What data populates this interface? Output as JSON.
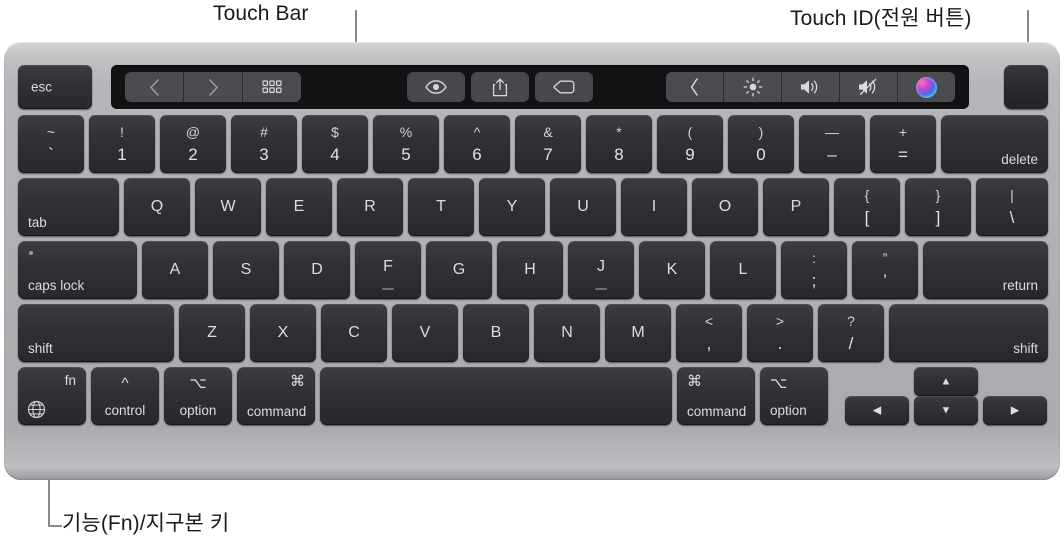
{
  "annotations": [
    {
      "id": "touch-bar",
      "label": "Touch Bar"
    },
    {
      "id": "touch-id",
      "label": "Touch ID(전원 버튼)"
    },
    {
      "id": "fn-globe",
      "label": "기능(Fn)/지구본 키"
    }
  ],
  "touch_bar": {
    "esc_label": "esc",
    "left_group": [
      {
        "name": "back-icon",
        "glyph": "chevron-left"
      },
      {
        "name": "forward-icon",
        "glyph": "chevron-right"
      },
      {
        "name": "grid-view-icon",
        "glyph": "grid"
      }
    ],
    "middle_group": [
      {
        "name": "quick-look-icon",
        "glyph": "eye"
      },
      {
        "name": "share-icon",
        "glyph": "share"
      },
      {
        "name": "tag-icon",
        "glyph": "tag"
      }
    ],
    "control_strip": [
      {
        "name": "expand-control-strip-icon",
        "glyph": "chevron-left"
      },
      {
        "name": "brightness-icon",
        "glyph": "sun"
      },
      {
        "name": "volume-up-icon",
        "glyph": "speaker-waves"
      },
      {
        "name": "mute-icon",
        "glyph": "speaker-muted"
      },
      {
        "name": "siri-icon",
        "glyph": "siri-orb"
      }
    ]
  },
  "touch_id": {
    "label": ""
  },
  "rows": {
    "numbers": [
      {
        "up": "~",
        "down": "`"
      },
      {
        "up": "!",
        "down": "1"
      },
      {
        "up": "@",
        "down": "2"
      },
      {
        "up": "#",
        "down": "3"
      },
      {
        "up": "$",
        "down": "4"
      },
      {
        "up": "%",
        "down": "5"
      },
      {
        "up": "^",
        "down": "6"
      },
      {
        "up": "&",
        "down": "7"
      },
      {
        "up": "*",
        "down": "8"
      },
      {
        "up": "(",
        "down": "9"
      },
      {
        "up": ")",
        "down": "0"
      },
      {
        "up": "—",
        "down": "–"
      },
      {
        "up": "+",
        "down": "="
      }
    ],
    "delete_label": "delete",
    "tab_label": "tab",
    "qwerty": [
      "Q",
      "W",
      "E",
      "R",
      "T",
      "Y",
      "U",
      "I",
      "O",
      "P"
    ],
    "qwerty_dual": [
      {
        "up": "{",
        "down": "["
      },
      {
        "up": "}",
        "down": "]"
      },
      {
        "up": "|",
        "down": "\\"
      }
    ],
    "caps_lock_label": "caps lock",
    "asdf": [
      "A",
      "S",
      "D",
      "F",
      "G",
      "H",
      "J",
      "K",
      "L"
    ],
    "asdf_dual": [
      {
        "up": ":",
        "down": ";"
      },
      {
        "up": "”",
        "down": "’"
      }
    ],
    "return_label": "return",
    "shift_left_label": "shift",
    "zxcv": [
      "Z",
      "X",
      "C",
      "V",
      "B",
      "N",
      "M"
    ],
    "zxcv_dual": [
      {
        "up": "<",
        "down": ","
      },
      {
        "up": ">",
        "down": "."
      },
      {
        "up": "?",
        "down": "/"
      }
    ],
    "shift_right_label": "shift",
    "bottom": {
      "fn_label": "fn",
      "control_glyph": "^",
      "control_label": "control",
      "option_glyph": "⌥",
      "option_label": "option",
      "command_glyph": "⌘",
      "command_label": "command",
      "space_label": "",
      "command_right_glyph": "⌘",
      "command_right_label": "command",
      "option_right_glyph": "⌥",
      "option_right_label": "option",
      "arrow_left": "◀",
      "arrow_up": "▲",
      "arrow_down": "▼",
      "arrow_right": "▶"
    }
  },
  "colors": {
    "body": "#aeb0b3",
    "key": "#2f3134",
    "key_text": "#dcdde0",
    "touch_bar_bg": "#111214",
    "touch_bar_btn": "#4a4c4f",
    "leader_line": "#8a8a8a",
    "annotation_text": "#1a1a1a"
  }
}
